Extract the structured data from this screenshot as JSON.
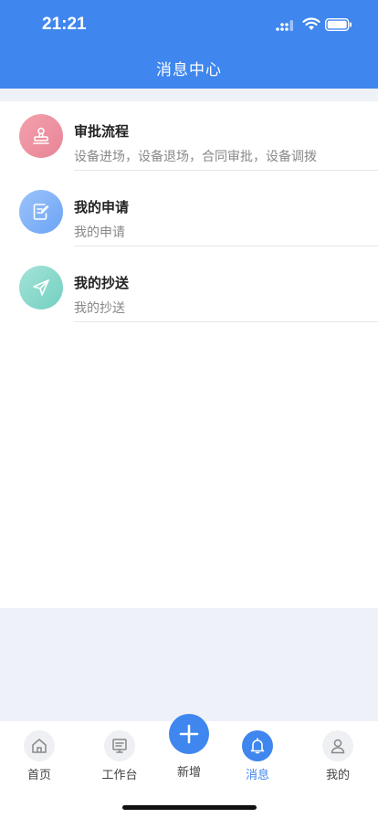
{
  "status_bar": {
    "time": "21:21"
  },
  "header": {
    "title": "消息中心"
  },
  "colors": {
    "brand": "#3f86ee",
    "background": "#eef1f7"
  },
  "messages": [
    {
      "title": "审批流程",
      "subtitle": "设备进场，设备退场，合同审批，设备调拨",
      "icon": "stamp-icon",
      "color": "#e88497"
    },
    {
      "title": "我的申请",
      "subtitle": "我的申请",
      "icon": "edit-document-icon",
      "color": "#6ba4f5"
    },
    {
      "title": "我的抄送",
      "subtitle": "我的抄送",
      "icon": "send-icon",
      "color": "#73d0c1"
    }
  ],
  "tabbar": {
    "home": {
      "label": "首页",
      "icon": "home-icon"
    },
    "workbench": {
      "label": "工作台",
      "icon": "monitor-icon"
    },
    "add": {
      "label": "新增",
      "icon": "plus-icon"
    },
    "messages": {
      "label": "消息",
      "icon": "bell-icon",
      "active": true
    },
    "mine": {
      "label": "我的",
      "icon": "user-icon"
    }
  }
}
